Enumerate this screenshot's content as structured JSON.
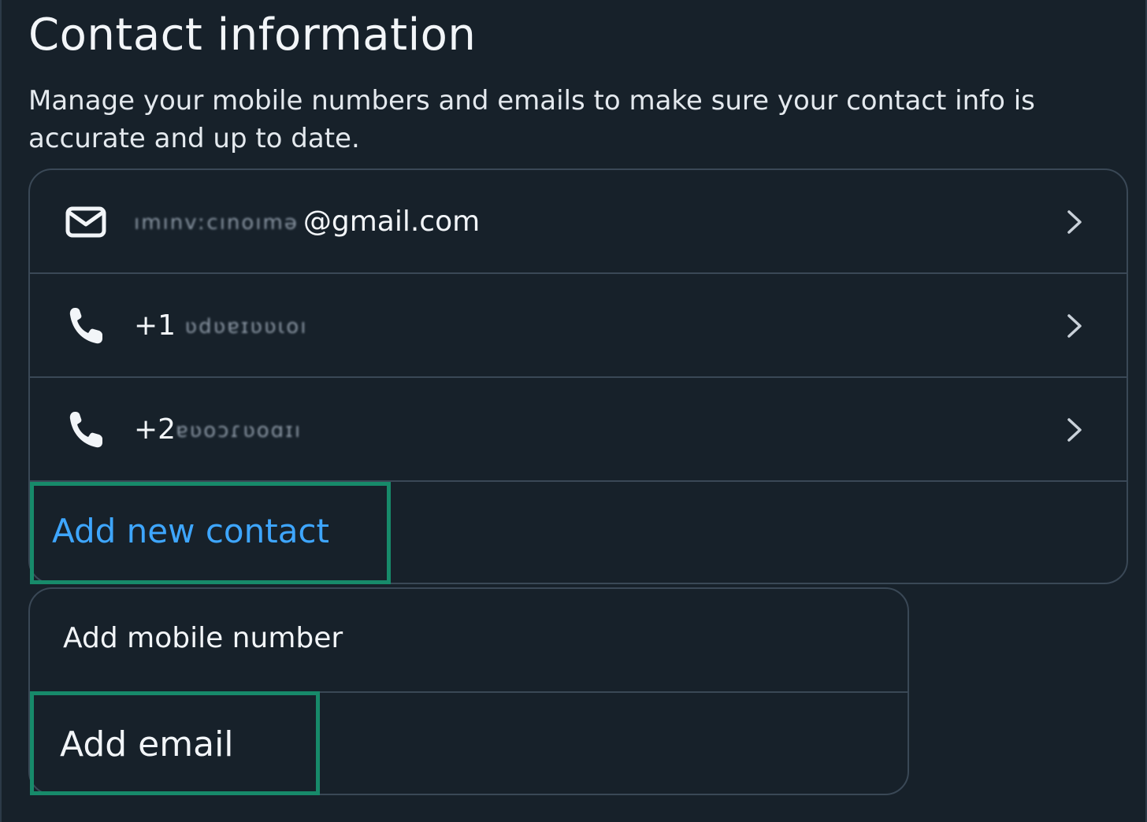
{
  "header": {
    "title": "Contact information",
    "subtitle": "Manage your mobile numbers and emails to make sure your contact info is accurate and up to date."
  },
  "contacts": [
    {
      "type": "email",
      "icon": "envelope-icon",
      "masked": "ımınvːcınoımə",
      "visible": "@gmail.com"
    },
    {
      "type": "phone",
      "icon": "phone-icon",
      "masked": "ʋdʋɐɪʋʋɩoı",
      "visible": "+1"
    },
    {
      "type": "phone",
      "icon": "phone-icon",
      "masked": "ɐʋoɔɾʋoɑɪı",
      "visible": "+2"
    }
  ],
  "add_new_contact": {
    "label": "Add new contact"
  },
  "add_menu": {
    "items": [
      {
        "label": "Add mobile number"
      },
      {
        "label": "Add email"
      }
    ]
  },
  "colors": {
    "background": "#17212a",
    "border": "#3a4856",
    "link": "#3ea6ff",
    "highlight": "#178a6a",
    "text": "#f2f5f8"
  }
}
